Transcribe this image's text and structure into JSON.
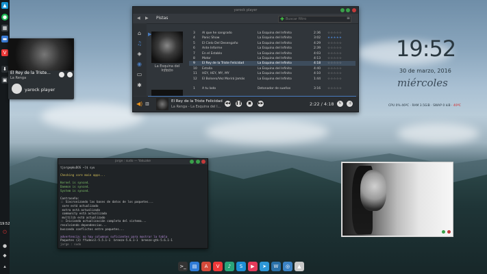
{
  "colors": {
    "accent": "#4a7cbf",
    "rating_active": "#4a7cbf",
    "volume_icon": "#e8901c",
    "terminal_yellow": "#d8c35a",
    "terminal_green": "#7fc36a",
    "red_text": "#d42525"
  },
  "left_panel": {
    "time": "19:52",
    "icons": [
      "arch-logo-icon",
      "spotify-icon",
      "grid-icon",
      "folder-icon",
      "vivaldi-icon",
      "download-icon",
      "apps-icon",
      "red-power-icon",
      "pin-icon",
      "drop-icon"
    ]
  },
  "mini_player": {
    "title": "El Rey de la Triste...",
    "artist": "La Renga",
    "app_name": "yarock player"
  },
  "yarock": {
    "window_title": "yarock player",
    "tab_label": "Pistas",
    "search_placeholder": "Buscar filtro",
    "sidebar_icons": [
      "home-icon",
      "music-icon",
      "shield-icon",
      "globe-icon",
      "monitor-icon",
      "gear-icon"
    ],
    "album_caption": "La Esquina del Infinito",
    "album_year": "2000",
    "tracks": [
      {
        "num": "3",
        "title": "Al que he sangrado",
        "album": "La Esquina del Infinito",
        "duration": "2:36",
        "stars": "☆☆☆☆☆",
        "active": false
      },
      {
        "num": "4",
        "title": "Panic Show",
        "album": "La Esquina del Infinito",
        "duration": "3:02",
        "stars": "★★★★★",
        "active": false
      },
      {
        "num": "5",
        "title": "El Cielo Del Desengaño",
        "album": "La Esquina del Infinito",
        "duration": "4:29",
        "stars": "☆☆☆☆☆",
        "active": false
      },
      {
        "num": "6",
        "title": "Ante Informe",
        "album": "La Esquina del Infinito",
        "duration": "2:39",
        "stars": "☆☆☆☆☆",
        "active": false
      },
      {
        "num": "7",
        "title": "En el Establo",
        "album": "La Esquina del Infinito",
        "duration": "4:03",
        "stars": "☆☆☆☆☆",
        "active": false
      },
      {
        "num": "8",
        "title": "Motor",
        "album": "La Esquina del Infinito",
        "duration": "4:13",
        "stars": "☆☆☆☆☆",
        "active": false
      },
      {
        "num": "9",
        "title": "El Rey de la Triste Felicidad",
        "album": "La Esquina del Infinito",
        "duration": "4:18",
        "stars": "☆☆☆☆☆",
        "active": true
      },
      {
        "num": "10",
        "title": "Estalla",
        "album": "La Esquina del Infinito",
        "duration": "4:40",
        "stars": "☆☆☆☆☆",
        "active": false
      },
      {
        "num": "11",
        "title": "HEY, HEY, MY, MY",
        "album": "La Esquina del Infinito",
        "duration": "4:10",
        "stars": "☆☆☆☆☆",
        "active": false
      },
      {
        "num": "12",
        "title": "El Bolsero/Vez Morirá Jamás",
        "album": "La Esquina del Infinito",
        "duration": "1:44",
        "stars": "☆☆☆☆☆",
        "active": false
      },
      {
        "num": "1",
        "title": "A tu lado",
        "album": "Detonador de sueños",
        "duration": "3:16",
        "stars": "☆☆☆☆☆",
        "active": false
      }
    ],
    "now_playing_title": "El Rey de la Triste Felicidad",
    "now_playing_artist": "La Renga - La Esquina del I...",
    "position": "2:22 / 4:18"
  },
  "clock": {
    "time": "19:52",
    "date": "30 de marzo, 2016",
    "weekday": "miércoles",
    "sys_cpu": "CPU 0% 46ºC",
    "sys_ram": "RAM 3.5GiB",
    "sys_swap": "SWAP 0 kiB",
    "sys_temp": "40ºC"
  },
  "terminal": {
    "title": "jorge : sudo — Yakuake",
    "lines": [
      {
        "text": "tjorge@kuDOS ~]$ syu",
        "color": "normal"
      },
      {
        "text": "",
        "color": "normal"
      },
      {
        "text": "Checking core main apps...",
        "color": "yellow"
      },
      {
        "text": "",
        "color": "normal"
      },
      {
        "text": "Kernel is synced.",
        "color": "green"
      },
      {
        "text": "Daemon is synced.",
        "color": "green"
      },
      {
        "text": "System is synced.",
        "color": "green"
      },
      {
        "text": "",
        "color": "normal"
      },
      {
        "text": "Contraseña:",
        "color": "normal"
      },
      {
        "text": ":: Sincronizando las bases de datos de los paquetes...",
        "color": "normal"
      },
      {
        "text": " core está actualizado",
        "color": "normal"
      },
      {
        "text": " extra está actualizado",
        "color": "normal"
      },
      {
        "text": " community está actualizado",
        "color": "normal"
      },
      {
        "text": " multilib está actualizado",
        "color": "normal"
      },
      {
        "text": ":: Iniciando actualización completa del sistema...",
        "color": "normal"
      },
      {
        "text": "resolviendo dependencias...",
        "color": "normal"
      },
      {
        "text": "buscando conflictos entre paquetes...",
        "color": "normal"
      },
      {
        "text": "",
        "color": "normal"
      },
      {
        "text": "advertencia: no hay columnas suficientes para mostrar la tabla",
        "color": "purple"
      },
      {
        "text": "Paquetes (3) ffudevil-5.5.1-1  breeze-5.6.1-1  breeze-gtk-5.6.1-1",
        "color": "normal"
      }
    ],
    "footer": "jorge : sudo"
  },
  "dock": {
    "items": [
      {
        "name": "terminal-icon",
        "color": "#333333",
        "glyph": ">_"
      },
      {
        "name": "files-icon",
        "color": "#2f7bd6",
        "glyph": "▤"
      },
      {
        "name": "pdf-icon",
        "color": "#d44a3a",
        "glyph": "A"
      },
      {
        "name": "vivaldi-icon",
        "color": "#ef3939",
        "glyph": "V"
      },
      {
        "name": "music-icon",
        "color": "#2aa57a",
        "glyph": "♪"
      },
      {
        "name": "skype-icon",
        "color": "#1d8fd6",
        "glyph": "S"
      },
      {
        "name": "youtube-icon",
        "color": "#e53b5a",
        "glyph": "▶"
      },
      {
        "name": "telegram-icon",
        "color": "#2d96d6",
        "glyph": "➤"
      },
      {
        "name": "wordpress-icon",
        "color": "#2a71a8",
        "glyph": "W"
      },
      {
        "name": "web-icon",
        "color": "#3b82c4",
        "glyph": "◎"
      },
      {
        "name": "tux-icon",
        "color": "#c8c8c8",
        "glyph": "▲"
      }
    ]
  }
}
